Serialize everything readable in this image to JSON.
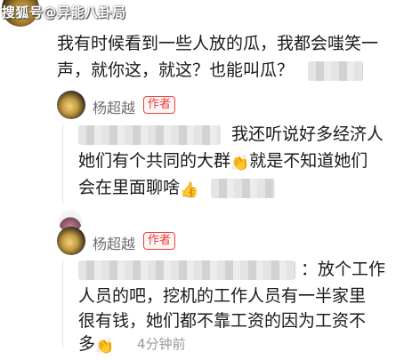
{
  "watermark": "搜狐号@异能八卦局",
  "top_comment": {
    "line1": "我有时候看到一些人放的瓜，我都会嗤笑一",
    "line2": "声，就你这，就这？也能叫瓜？"
  },
  "reply1": {
    "username": "杨超越",
    "badge": "作者",
    "line1": "我还听说好多经济人",
    "line2a": "她们有个共同的大群",
    "emoji1": "👏",
    "line2b": "就是不知道她们",
    "line3": "会在里面聊啥",
    "emoji2": "👍"
  },
  "reply2": {
    "username": "杨超越",
    "badge": "作者",
    "line1": "：放个工作",
    "line2": "人员的吧，挖机的工作人员有一半家里",
    "line3": "很有钱，她们都不靠工资的因为工资不",
    "line4": "多",
    "emoji": "👏",
    "time": "4分钟前"
  }
}
